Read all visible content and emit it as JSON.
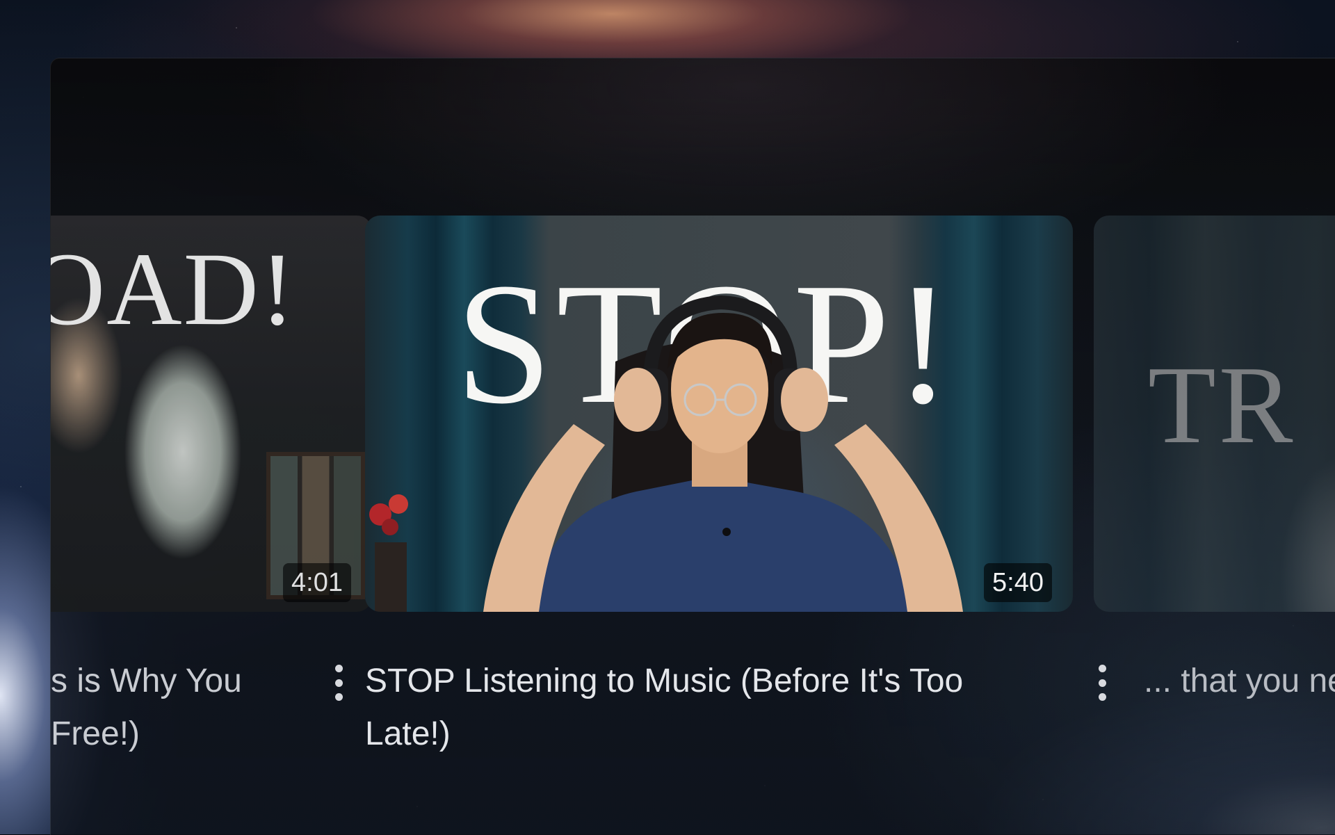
{
  "shelf": {
    "videos": [
      {
        "thumb_text": "OAD!",
        "duration": "4:01",
        "title": "s is Why You Free!)"
      },
      {
        "thumb_text": "STOP!",
        "duration": "5:40",
        "title": "STOP Listening to Music (Before It's Too Late!)"
      },
      {
        "thumb_text": "TR",
        "title": "... that you nee"
      }
    ]
  }
}
